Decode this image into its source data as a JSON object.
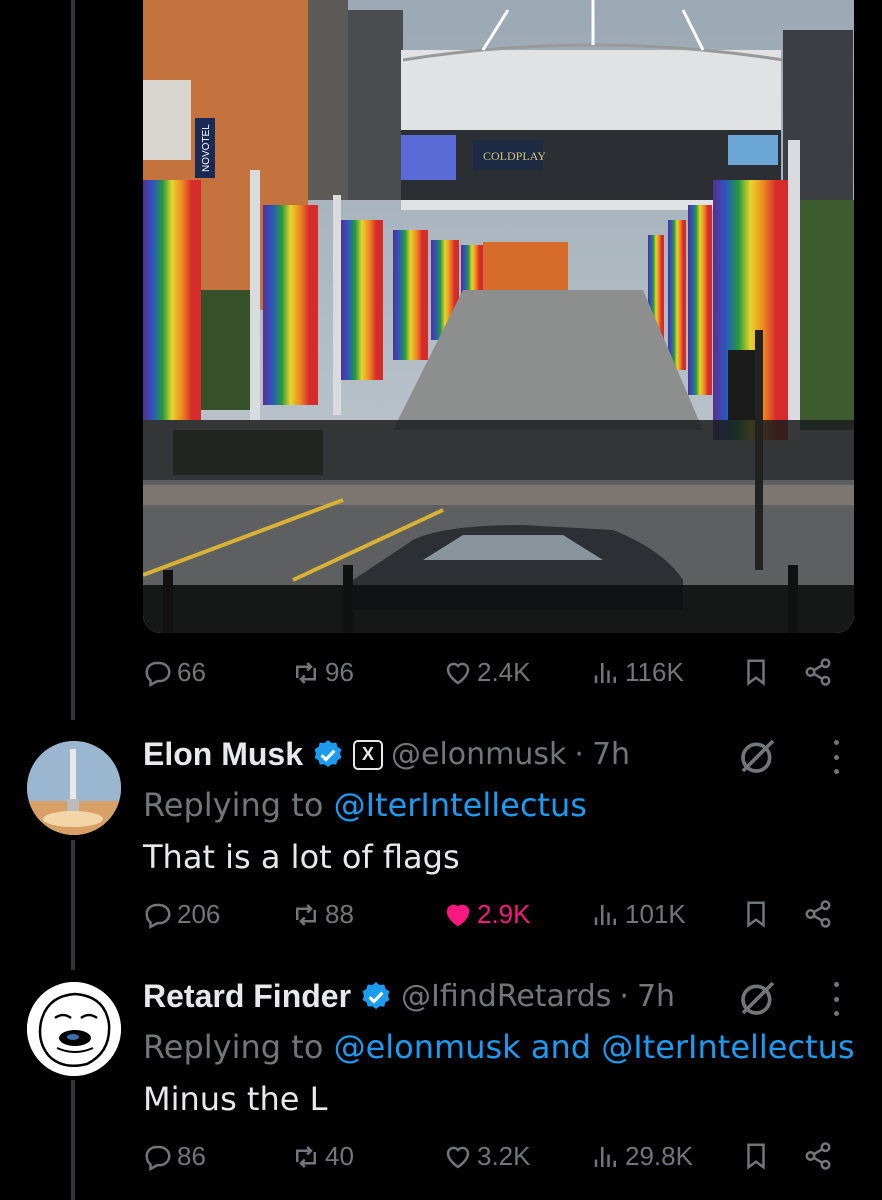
{
  "tweet1_actions": {
    "replies": "66",
    "reposts": "96",
    "likes": "2.4K",
    "views": "116K"
  },
  "photo_signage": {
    "billboard": "COLDPLAY",
    "hotel_sign": "NOVOTEL"
  },
  "tweet2": {
    "name": "Elon Musk",
    "affiliate_badge": "X",
    "handle": "@elonmusk",
    "sep": "·",
    "time": "7h",
    "replying_prefix": "Replying to",
    "replying_to": "@IterIntellectus",
    "text": "That is a lot of flags",
    "actions": {
      "replies": "206",
      "reposts": "88",
      "likes": "2.9K",
      "views": "101K"
    }
  },
  "tweet3": {
    "name": "Retard Finder",
    "handle": "@IfindRetards",
    "sep": "·",
    "time": "7h",
    "replying_prefix": "Replying to",
    "replying_to": "@elonmusk and @IterIntellectus",
    "text": "Minus the L",
    "actions": {
      "replies": "86",
      "reposts": "40",
      "likes": "3.2K",
      "views": "29.8K"
    }
  },
  "colors": {
    "background": "#000000",
    "muted": "#71767b",
    "link": "#1d9bf0",
    "like": "#f91880",
    "verified": "#1d9bf0"
  }
}
